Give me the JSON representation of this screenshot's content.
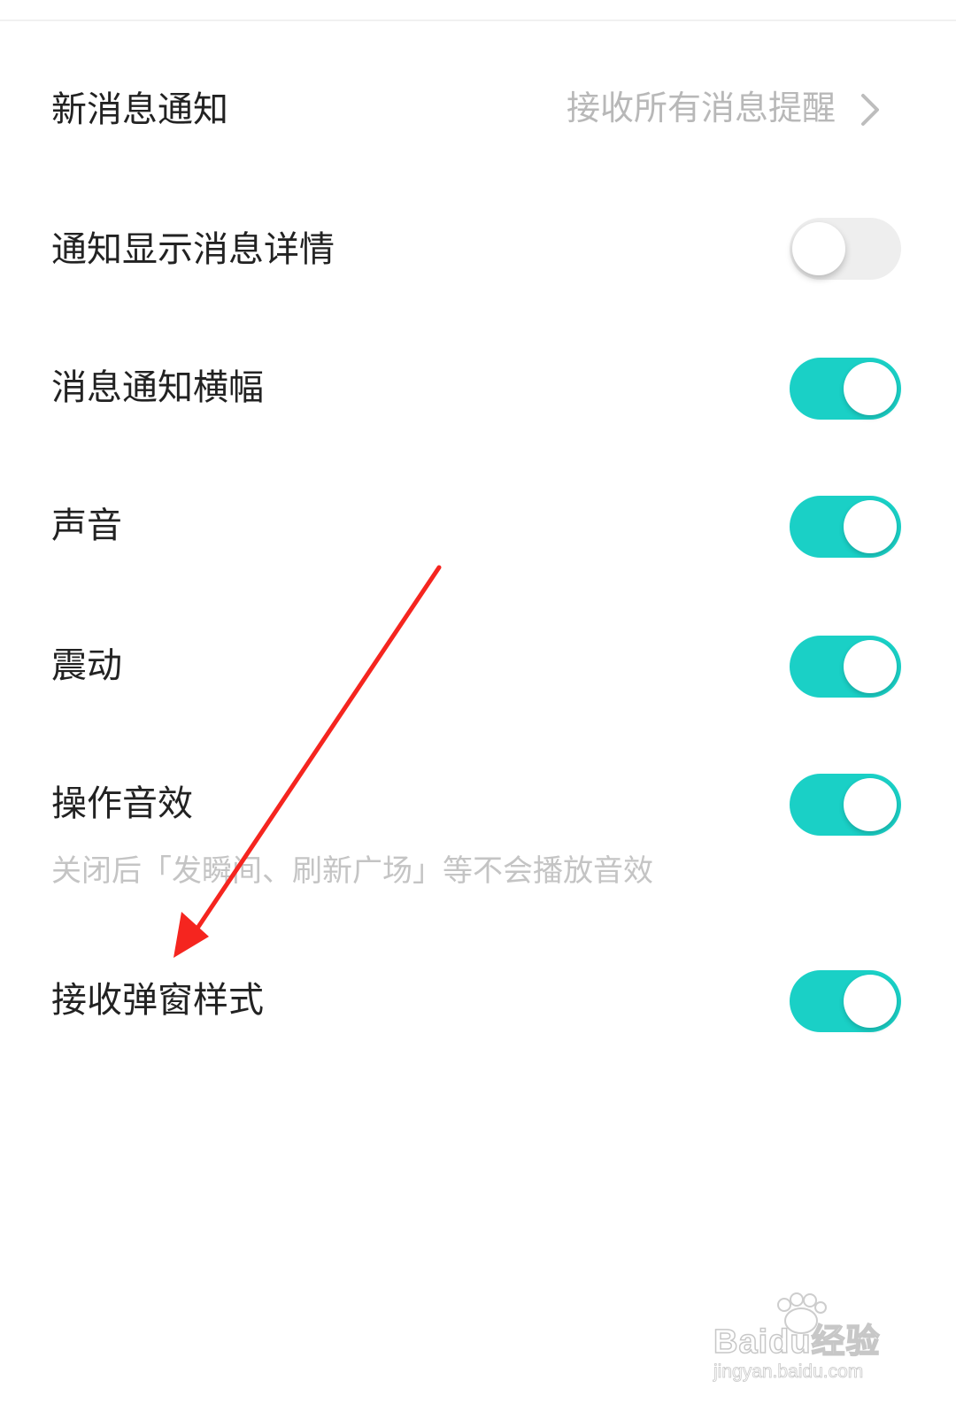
{
  "settings": {
    "new_message": {
      "label": "新消息通知",
      "value": "接收所有消息提醒",
      "chevron_icon": "chevron-right-icon"
    },
    "show_details": {
      "label": "通知显示消息详情",
      "enabled": false
    },
    "banner": {
      "label": "消息通知横幅",
      "enabled": true
    },
    "sound": {
      "label": "声音",
      "enabled": true
    },
    "vibrate": {
      "label": "震动",
      "enabled": true
    },
    "op_sound": {
      "label": "操作音效",
      "enabled": true,
      "hint": "关闭后「发瞬间、刷新广场」等不会播放音效"
    },
    "popup_style": {
      "label": "接收弹窗样式",
      "enabled": true
    }
  },
  "annotation": {
    "arrow_color": "#f5251f",
    "arrow_target": "接收弹窗样式"
  },
  "watermark": {
    "brand": "Baidu经验",
    "url": "jingyan.baidu.com"
  },
  "colors": {
    "toggle_on": "#1ad0c6",
    "toggle_off": "#eeeeee",
    "label": "#222222",
    "secondary": "#b8b8b8"
  }
}
